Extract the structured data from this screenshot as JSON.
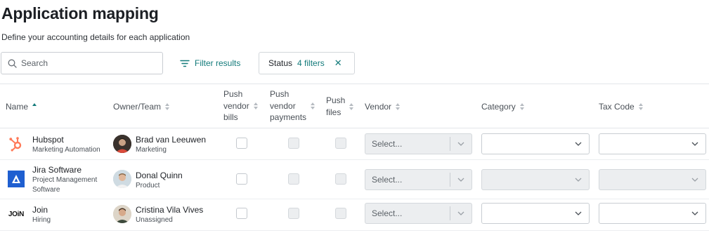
{
  "header": {
    "title": "Application mapping",
    "subtitle": "Define your accounting details for each application"
  },
  "toolbar": {
    "search_placeholder": "Search",
    "filter_label": "Filter results",
    "status_label": "Status",
    "status_count": "4 filters"
  },
  "columns": {
    "name": "Name",
    "owner": "Owner/Team",
    "push_bills": [
      "Push",
      "vendor",
      "bills"
    ],
    "push_payments": [
      "Push",
      "vendor",
      "payments"
    ],
    "push_files": [
      "Push",
      "files"
    ],
    "vendor": "Vendor",
    "category": "Category",
    "tax_code": "Tax Code"
  },
  "rows": [
    {
      "app": "Hubspot",
      "app_sub": "Marketing Automation",
      "logo": "hubspot-logo",
      "owner": "Brad van Leeuwen",
      "team": "Marketing",
      "vendor_placeholder": "Select..."
    },
    {
      "app": "Jira Software",
      "app_sub": "Project Management Software",
      "logo": "jira-logo",
      "owner": "Donal Quinn",
      "team": "Product",
      "vendor_placeholder": "Select..."
    },
    {
      "app": "Join",
      "app_sub": "Hiring",
      "logo": "join-logo",
      "logo_text": "JOiN",
      "owner": "Cristina Vila Vives",
      "team": "Unassigned",
      "vendor_placeholder": "Select..."
    }
  ],
  "colors": {
    "accent": "#127a7a",
    "hubspot": "#ff7a59",
    "jira": "#1f5fd0"
  }
}
